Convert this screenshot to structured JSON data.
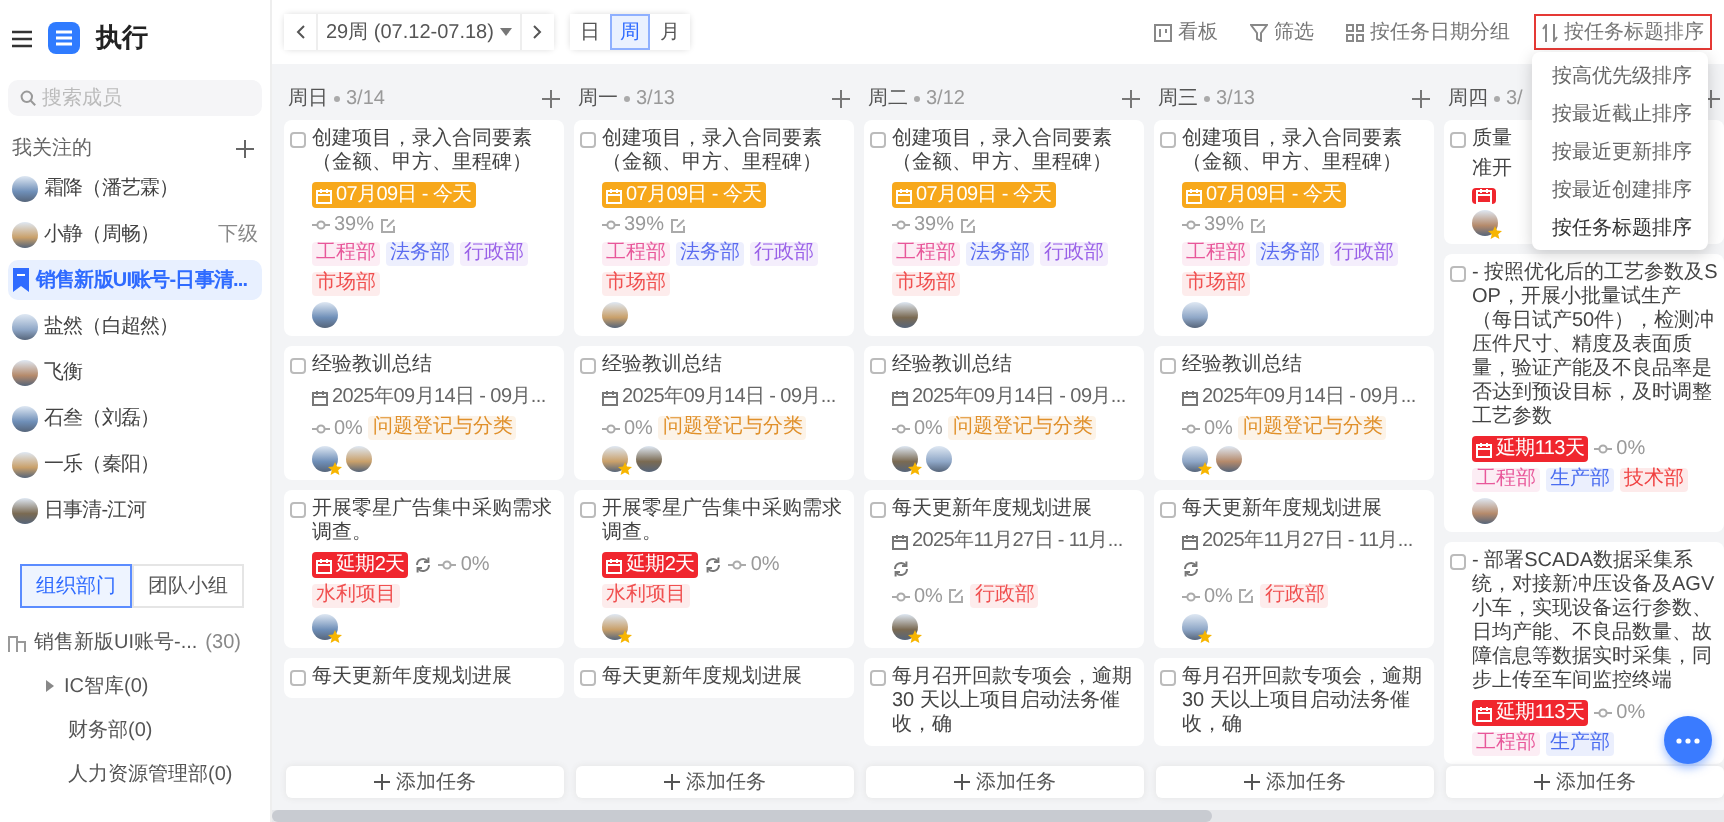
{
  "sidebar": {
    "title": "执行",
    "search": {
      "placeholder": "搜索成员"
    },
    "section_title": "我关注的",
    "members": [
      {
        "name": "霜降（潘艺霖）",
        "kind": "person",
        "selected": false
      },
      {
        "name": "小静（周畅）",
        "kind": "person",
        "selected": false,
        "note": "下级"
      },
      {
        "name": "销售新版UI账号-日事清...",
        "kind": "account",
        "selected": true
      },
      {
        "name": "盐然（白超然）",
        "kind": "person",
        "selected": false
      },
      {
        "name": "飞衡",
        "kind": "person",
        "selected": false
      },
      {
        "name": "石叁（刘磊）",
        "kind": "person",
        "selected": false
      },
      {
        "name": "一乐（秦阳）",
        "kind": "person",
        "selected": false
      },
      {
        "name": "日事清-江河",
        "kind": "person",
        "selected": false
      }
    ],
    "group_tabs": [
      {
        "label": "组织部门",
        "selected": true
      },
      {
        "label": "团队小组",
        "selected": false
      }
    ],
    "tree": [
      {
        "label": "销售新版UI账号-...",
        "count": "(30)",
        "children": [
          {
            "label": "IC智库(0)",
            "expanded": false
          },
          {
            "label": "财务部(0)"
          },
          {
            "label": "人力资源管理部(0)"
          }
        ]
      }
    ]
  },
  "toolbar": {
    "week": "29周 (07.12-07.18)",
    "views": [
      {
        "label": "日",
        "selected": false
      },
      {
        "label": "周",
        "selected": true
      },
      {
        "label": "月",
        "selected": false
      }
    ],
    "actions": [
      {
        "label": "看板",
        "kind": "board",
        "open": false
      },
      {
        "label": "筛选",
        "kind": "filter",
        "open": false
      },
      {
        "label": "按任务日期分组",
        "kind": "group",
        "open": false
      },
      {
        "label": "按任务标题排序",
        "kind": "sort",
        "open": true
      }
    ]
  },
  "sort_menu": [
    {
      "label": "按高优先级排序",
      "selected": false
    },
    {
      "label": "按最近截止排序",
      "selected": false
    },
    {
      "label": "按最近更新排序",
      "selected": false
    },
    {
      "label": "按最近创建排序",
      "selected": false
    },
    {
      "label": "按任务标题排序",
      "selected": true
    }
  ],
  "columns": [
    {
      "day": "周日",
      "count": "3/14",
      "add_label": "添加任务",
      "cards": [
        {
          "checked": false,
          "title": "创建项目，录入合同要素（金额、甲方、里程碑）",
          "lines": [
            {
              "items": [
                {
                  "kind": "date_today",
                  "text": "07月09日 - 今天"
                }
              ]
            },
            {
              "items": [
                {
                  "kind": "progress",
                  "text": "39%"
                },
                {
                  "kind": "edit"
                }
              ]
            },
            {
              "items": [
                {
                  "kind": "tag",
                  "text": "工程部",
                  "color": "#e8589a"
                },
                {
                  "kind": "tag",
                  "text": "法务部",
                  "color": "#5b6cf0"
                },
                {
                  "kind": "tag",
                  "text": "行政部",
                  "color": "#9a62e8"
                },
                {
                  "kind": "tag",
                  "text": "市场部",
                  "color": "#f05050"
                }
              ]
            }
          ],
          "avatars": [
            {
              "star": false
            }
          ]
        },
        {
          "checked": false,
          "title": "经验教训总结",
          "lines": [
            {
              "items": [
                {
                  "kind": "date",
                  "text": "2025年09月14日 - 09月..."
                }
              ]
            },
            {
              "items": [
                {
                  "kind": "progress",
                  "text": "0%"
                },
                {
                  "kind": "tag",
                  "text": "问题登记与分类",
                  "color": "#e0902a"
                }
              ]
            }
          ],
          "avatars": [
            {
              "star": true
            },
            {
              "star": false
            }
          ]
        },
        {
          "checked": false,
          "title": "开展零星广告集中采购需求调查。",
          "lines": [
            {
              "items": [
                {
                  "kind": "date_overdue",
                  "text": "延期2天"
                },
                {
                  "kind": "repeat"
                },
                {
                  "kind": "progress",
                  "text": "0%"
                }
              ]
            },
            {
              "items": [
                {
                  "kind": "tag",
                  "text": "水利项目",
                  "color": "#f05050"
                }
              ]
            }
          ],
          "avatars": [
            {
              "star": true
            }
          ]
        },
        {
          "checked": false,
          "title": "每天更新年度规划进展"
        }
      ]
    },
    {
      "day": "周一",
      "count": "3/13",
      "add_label": "添加任务",
      "cards": [
        {
          "checked": false,
          "title": "创建项目，录入合同要素（金额、甲方、里程碑）",
          "lines": [
            {
              "items": [
                {
                  "kind": "date_today",
                  "text": "07月09日 - 今天"
                }
              ]
            },
            {
              "items": [
                {
                  "kind": "progress",
                  "text": "39%"
                },
                {
                  "kind": "edit"
                }
              ]
            },
            {
              "items": [
                {
                  "kind": "tag",
                  "text": "工程部",
                  "color": "#e8589a"
                },
                {
                  "kind": "tag",
                  "text": "法务部",
                  "color": "#5b6cf0"
                },
                {
                  "kind": "tag",
                  "text": "行政部",
                  "color": "#9a62e8"
                },
                {
                  "kind": "tag",
                  "text": "市场部",
                  "color": "#f05050"
                }
              ]
            }
          ],
          "avatars": [
            {
              "star": false
            }
          ]
        },
        {
          "checked": false,
          "title": "经验教训总结",
          "lines": [
            {
              "items": [
                {
                  "kind": "date",
                  "text": "2025年09月14日 - 09月..."
                }
              ]
            },
            {
              "items": [
                {
                  "kind": "progress",
                  "text": "0%"
                },
                {
                  "kind": "tag",
                  "text": "问题登记与分类",
                  "color": "#e0902a"
                }
              ]
            }
          ],
          "avatars": [
            {
              "star": true
            },
            {
              "star": false
            }
          ]
        },
        {
          "checked": false,
          "title": "开展零星广告集中采购需求调查。",
          "lines": [
            {
              "items": [
                {
                  "kind": "date_overdue",
                  "text": "延期2天"
                },
                {
                  "kind": "repeat"
                },
                {
                  "kind": "progress",
                  "text": "0%"
                }
              ]
            },
            {
              "items": [
                {
                  "kind": "tag",
                  "text": "水利项目",
                  "color": "#f05050"
                }
              ]
            }
          ],
          "avatars": [
            {
              "star": true
            }
          ]
        },
        {
          "checked": false,
          "title": "每天更新年度规划进展"
        }
      ]
    },
    {
      "day": "周二",
      "count": "3/12",
      "add_label": "添加任务",
      "cards": [
        {
          "checked": false,
          "title": "创建项目，录入合同要素（金额、甲方、里程碑）",
          "lines": [
            {
              "items": [
                {
                  "kind": "date_today",
                  "text": "07月09日 - 今天"
                }
              ]
            },
            {
              "items": [
                {
                  "kind": "progress",
                  "text": "39%"
                },
                {
                  "kind": "edit"
                }
              ]
            },
            {
              "items": [
                {
                  "kind": "tag",
                  "text": "工程部",
                  "color": "#e8589a"
                },
                {
                  "kind": "tag",
                  "text": "法务部",
                  "color": "#5b6cf0"
                },
                {
                  "kind": "tag",
                  "text": "行政部",
                  "color": "#9a62e8"
                },
                {
                  "kind": "tag",
                  "text": "市场部",
                  "color": "#f05050"
                }
              ]
            }
          ],
          "avatars": [
            {
              "star": false
            }
          ]
        },
        {
          "checked": false,
          "title": "经验教训总结",
          "lines": [
            {
              "items": [
                {
                  "kind": "date",
                  "text": "2025年09月14日 - 09月..."
                }
              ]
            },
            {
              "items": [
                {
                  "kind": "progress",
                  "text": "0%"
                },
                {
                  "kind": "tag",
                  "text": "问题登记与分类",
                  "color": "#e0902a"
                }
              ]
            }
          ],
          "avatars": [
            {
              "star": true
            },
            {
              "star": false
            }
          ]
        },
        {
          "checked": false,
          "title": "每天更新年度规划进展",
          "lines": [
            {
              "items": [
                {
                  "kind": "date",
                  "text": "2025年11月27日 - 11月..."
                }
              ]
            },
            {
              "items": [
                {
                  "kind": "repeat"
                }
              ]
            },
            {
              "items": [
                {
                  "kind": "progress",
                  "text": "0%"
                },
                {
                  "kind": "edit"
                },
                {
                  "kind": "tag",
                  "text": "行政部",
                  "color": "#f05050"
                }
              ]
            }
          ],
          "avatars": [
            {
              "star": true
            }
          ]
        },
        {
          "checked": false,
          "title": "每月召开回款专项会，逾期 30 天以上项目启动法务催收，确"
        }
      ]
    },
    {
      "day": "周三",
      "count": "3/13",
      "add_label": "添加任务",
      "cards": [
        {
          "checked": false,
          "title": "创建项目，录入合同要素（金额、甲方、里程碑）",
          "lines": [
            {
              "items": [
                {
                  "kind": "date_today",
                  "text": "07月09日 - 今天"
                }
              ]
            },
            {
              "items": [
                {
                  "kind": "progress",
                  "text": "39%"
                },
                {
                  "kind": "edit"
                }
              ]
            },
            {
              "items": [
                {
                  "kind": "tag",
                  "text": "工程部",
                  "color": "#e8589a"
                },
                {
                  "kind": "tag",
                  "text": "法务部",
                  "color": "#5b6cf0"
                },
                {
                  "kind": "tag",
                  "text": "行政部",
                  "color": "#9a62e8"
                },
                {
                  "kind": "tag",
                  "text": "市场部",
                  "color": "#f05050"
                }
              ]
            }
          ],
          "avatars": [
            {
              "star": false
            }
          ]
        },
        {
          "checked": false,
          "title": "经验教训总结",
          "lines": [
            {
              "items": [
                {
                  "kind": "date",
                  "text": "2025年09月14日 - 09月..."
                }
              ]
            },
            {
              "items": [
                {
                  "kind": "progress",
                  "text": "0%"
                },
                {
                  "kind": "tag",
                  "text": "问题登记与分类",
                  "color": "#e0902a"
                }
              ]
            }
          ],
          "avatars": [
            {
              "star": true
            },
            {
              "star": false
            }
          ]
        },
        {
          "checked": false,
          "title": "每天更新年度规划进展",
          "lines": [
            {
              "items": [
                {
                  "kind": "date",
                  "text": "2025年11月27日 - 11月..."
                }
              ]
            },
            {
              "items": [
                {
                  "kind": "repeat"
                }
              ]
            },
            {
              "items": [
                {
                  "kind": "progress",
                  "text": "0%"
                },
                {
                  "kind": "edit"
                },
                {
                  "kind": "tag",
                  "text": "行政部",
                  "color": "#f05050"
                }
              ]
            }
          ],
          "avatars": [
            {
              "star": true
            }
          ]
        },
        {
          "checked": false,
          "title": "每月召开回款专项会，逾期 30 天以上项目启动法务催收，确"
        }
      ]
    },
    {
      "day": "周四",
      "count": "3/",
      "add_label": "添加任务",
      "cards": [
        {
          "checked": false,
          "title_parts": [
            "质量",
            "准开"
          ],
          "lines": [
            {
              "items": [
                {
                  "kind": "date_overdue"
                }
              ]
            }
          ],
          "avatars": [
            {
              "star": true
            }
          ]
        },
        {
          "checked": false,
          "title": "- 按照优化后的工艺参数及SOP，开展小批量试生产（每日试产50件），检测冲压件尺寸、精度及表面质量，验证产能及不良品率是否达到预设目标，及时调整工艺参数",
          "lines": [
            {
              "items": [
                {
                  "kind": "date_overdue",
                  "text": "延期113天"
                },
                {
                  "kind": "progress",
                  "text": "0%"
                }
              ]
            },
            {
              "items": [
                {
                  "kind": "tag",
                  "text": "工程部",
                  "color": "#e8589a"
                },
                {
                  "kind": "tag",
                  "text": "生产部",
                  "color": "#4a6cf0"
                },
                {
                  "kind": "tag",
                  "text": "技术部",
                  "color": "#f04040"
                }
              ]
            }
          ],
          "avatars": [
            {
              "star": false
            }
          ]
        },
        {
          "checked": false,
          "title": "- 部署SCADA数据采集系统，对接新冲压设备及AGV小车，实现设备运行参数、日均产能、不良品数量、故障信息等数据实时采集，同步上传至车间监控终端",
          "lines": [
            {
              "items": [
                {
                  "kind": "date_overdue",
                  "text": "延期113天"
                },
                {
                  "kind": "progress",
                  "text": "0%"
                }
              ]
            },
            {
              "items": [
                {
                  "kind": "tag",
                  "text": "工程部",
                  "color": "#e8589a"
                },
                {
                  "kind": "tag",
                  "text": "生产部",
                  "color": "#4a6cf0"
                }
              ]
            }
          ]
        }
      ]
    }
  ]
}
